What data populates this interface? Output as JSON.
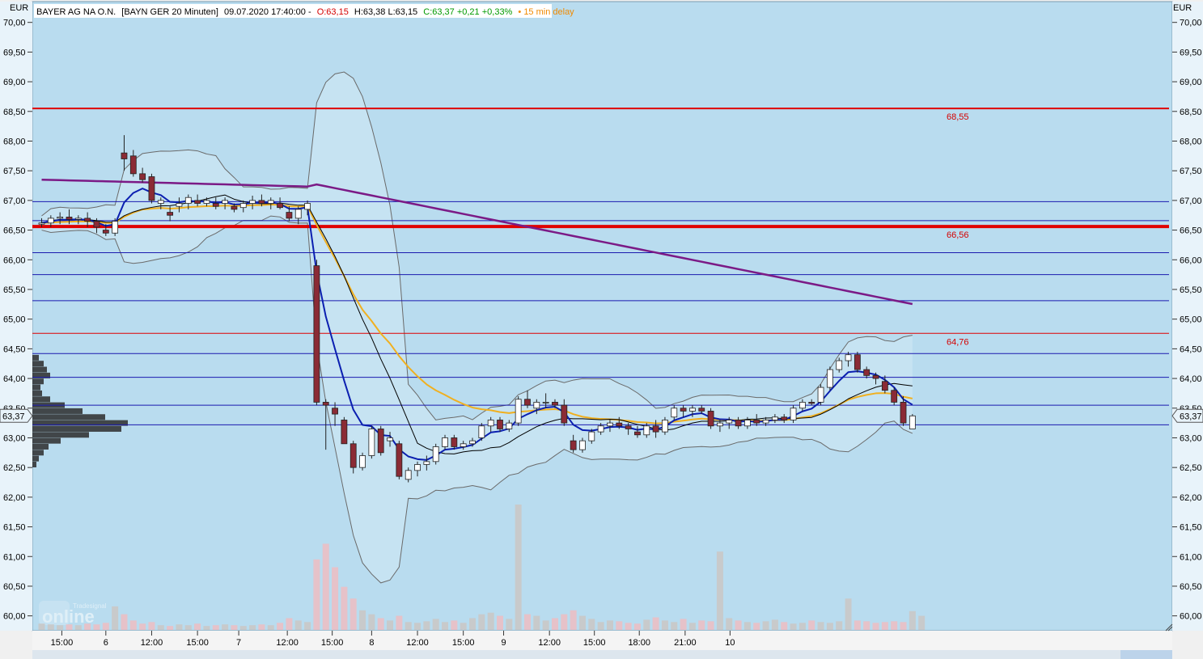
{
  "header": {
    "name": "BAYER AG NA O.N.",
    "symbol": "[BAYN GER 20 Minuten]",
    "datetime": "09.07.2020 17:40:00 -",
    "open": "O:63,15",
    "high_low": "H:63,38 L:63,15",
    "close_change": "C:63,37 +0,21 +0,33%",
    "delay": "• 15 min delay"
  },
  "currency_left": "EUR",
  "currency_right": "EUR",
  "last_price_label": "63,37",
  "watermark": {
    "brand": "Tradesignal",
    "text": "online"
  },
  "colors": {
    "plot_bg": "#b9dcef",
    "candle_up": "#ffffff",
    "candle_down": "#8b2b35",
    "resistance": "#e00000",
    "support_lines": "#1a1aaf",
    "sma_long": "#7b1a86",
    "sma_mid": "#f0b020",
    "ema_fast": "#0b1fb0",
    "ema_slow": "#000000",
    "bollinger": "#6a6a6a",
    "volume": "#c8c8c8"
  },
  "chart_data": {
    "type": "candlestick",
    "interval": "20 Minuten",
    "y_ticks": [
      "60,00",
      "60,50",
      "61,00",
      "61,50",
      "62,00",
      "62,50",
      "63,00",
      "63,50",
      "64,00",
      "64,50",
      "65,00",
      "65,50",
      "66,00",
      "66,50",
      "67,00",
      "67,50",
      "68,00",
      "68,50",
      "69,00",
      "69,50",
      "70,00"
    ],
    "ylim": [
      59.75,
      70.35
    ],
    "x_ticks": [
      {
        "bar": 2.2,
        "label": "15:00"
      },
      {
        "bar": 7,
        "label": "6"
      },
      {
        "bar": 12,
        "label": "12:00"
      },
      {
        "bar": 17,
        "label": "15:00"
      },
      {
        "bar": 21.5,
        "label": "7"
      },
      {
        "bar": 26.8,
        "label": "12:00"
      },
      {
        "bar": 31.7,
        "label": "15:00"
      },
      {
        "bar": 36,
        "label": "8"
      },
      {
        "bar": 41,
        "label": "12:00"
      },
      {
        "bar": 46,
        "label": "15:00"
      },
      {
        "bar": 50.4,
        "label": "9"
      },
      {
        "bar": 55.4,
        "label": "12:00"
      },
      {
        "bar": 60.3,
        "label": "15:00"
      },
      {
        "bar": 65.2,
        "label": "18:00"
      },
      {
        "bar": 70.2,
        "label": "21:00"
      },
      {
        "bar": 75.1,
        "label": "10"
      }
    ],
    "horizontal_levels": [
      {
        "price": 68.55,
        "label": "68,55",
        "role": "resistance",
        "width": 2
      },
      {
        "price": 66.56,
        "label": "66,56",
        "role": "resistance",
        "width": 4
      },
      {
        "price": 64.76,
        "label": "64,76",
        "role": "resistance",
        "width": 1
      },
      {
        "price": 66.98,
        "label": "",
        "role": "support",
        "width": 1
      },
      {
        "price": 66.66,
        "label": "",
        "role": "support",
        "width": 1
      },
      {
        "price": 66.12,
        "label": "",
        "role": "support",
        "width": 1
      },
      {
        "price": 65.75,
        "label": "",
        "role": "support",
        "width": 1
      },
      {
        "price": 65.31,
        "label": "",
        "role": "support",
        "width": 1
      },
      {
        "price": 64.42,
        "label": "",
        "role": "support",
        "width": 1
      },
      {
        "price": 64.02,
        "label": "",
        "role": "support",
        "width": 1
      },
      {
        "price": 63.55,
        "label": "",
        "role": "support",
        "width": 1
      },
      {
        "price": 63.22,
        "label": "",
        "role": "support",
        "width": 1
      }
    ],
    "candles": [
      [
        66.6,
        66.7,
        66.55,
        66.62
      ],
      [
        66.62,
        66.75,
        66.55,
        66.7
      ],
      [
        66.7,
        66.8,
        66.6,
        66.72
      ],
      [
        66.72,
        66.85,
        66.6,
        66.68
      ],
      [
        66.68,
        66.75,
        66.6,
        66.7
      ],
      [
        66.7,
        66.8,
        66.55,
        66.65
      ],
      [
        66.65,
        66.7,
        66.45,
        66.55
      ],
      [
        66.5,
        66.6,
        66.4,
        66.45
      ],
      [
        66.45,
        66.7,
        66.4,
        66.65
      ],
      [
        67.8,
        68.1,
        67.5,
        67.7
      ],
      [
        67.75,
        67.85,
        67.4,
        67.45
      ],
      [
        67.45,
        67.55,
        67.3,
        67.35
      ],
      [
        67.4,
        67.45,
        66.95,
        67.0
      ],
      [
        66.95,
        67.05,
        66.85,
        67.0
      ],
      [
        66.8,
        66.9,
        66.65,
        66.75
      ],
      [
        66.9,
        67.05,
        66.8,
        66.95
      ],
      [
        66.95,
        67.1,
        66.85,
        67.05
      ],
      [
        67.0,
        67.1,
        66.9,
        66.95
      ],
      [
        66.95,
        67.05,
        66.9,
        67.0
      ],
      [
        66.95,
        67.05,
        66.85,
        66.9
      ],
      [
        66.95,
        67.05,
        66.85,
        67.0
      ],
      [
        66.9,
        66.95,
        66.8,
        66.85
      ],
      [
        66.88,
        67.0,
        66.8,
        66.95
      ],
      [
        66.95,
        67.08,
        66.85,
        67.0
      ],
      [
        67.0,
        67.1,
        66.9,
        66.95
      ],
      [
        66.95,
        67.05,
        66.85,
        67.0
      ],
      [
        66.95,
        67.05,
        66.85,
        66.88
      ],
      [
        66.8,
        66.9,
        66.65,
        66.7
      ],
      [
        66.7,
        66.9,
        66.6,
        66.85
      ],
      [
        66.85,
        67.0,
        66.75,
        66.95
      ],
      [
        65.9,
        66.0,
        63.55,
        63.6
      ],
      [
        63.6,
        63.65,
        62.8,
        63.55
      ],
      [
        63.5,
        63.6,
        63.2,
        63.4
      ],
      [
        63.3,
        63.35,
        62.9,
        62.9
      ],
      [
        62.9,
        62.95,
        62.4,
        62.5
      ],
      [
        62.5,
        62.75,
        62.45,
        62.7
      ],
      [
        62.7,
        63.2,
        62.65,
        63.15
      ],
      [
        63.15,
        63.2,
        62.7,
        62.75
      ],
      [
        62.95,
        63.1,
        62.85,
        63.0
      ],
      [
        62.9,
        62.95,
        62.3,
        62.35
      ],
      [
        62.3,
        62.5,
        62.25,
        62.45
      ],
      [
        62.45,
        62.6,
        62.35,
        62.55
      ],
      [
        62.55,
        62.7,
        62.45,
        62.6
      ],
      [
        62.6,
        62.9,
        62.55,
        62.85
      ],
      [
        62.85,
        63.05,
        62.8,
        63.0
      ],
      [
        63.0,
        63.05,
        62.8,
        62.85
      ],
      [
        62.85,
        62.95,
        62.8,
        62.9
      ],
      [
        62.9,
        63.0,
        62.85,
        62.95
      ],
      [
        63.0,
        63.25,
        62.95,
        63.2
      ],
      [
        63.2,
        63.35,
        63.1,
        63.3
      ],
      [
        63.3,
        63.35,
        63.1,
        63.15
      ],
      [
        63.15,
        63.3,
        63.1,
        63.25
      ],
      [
        63.25,
        63.7,
        63.2,
        63.65
      ],
      [
        63.65,
        63.8,
        63.5,
        63.55
      ],
      [
        63.5,
        63.65,
        63.4,
        63.6
      ],
      [
        63.6,
        63.75,
        63.5,
        63.6
      ],
      [
        63.6,
        63.65,
        63.5,
        63.55
      ],
      [
        63.55,
        63.65,
        63.2,
        63.25
      ],
      [
        62.95,
        63.05,
        62.75,
        62.8
      ],
      [
        62.8,
        63.0,
        62.75,
        62.95
      ],
      [
        62.95,
        63.15,
        62.9,
        63.1
      ],
      [
        63.1,
        63.25,
        63.05,
        63.2
      ],
      [
        63.2,
        63.3,
        63.1,
        63.25
      ],
      [
        63.25,
        63.35,
        63.15,
        63.2
      ],
      [
        63.2,
        63.25,
        63.05,
        63.15
      ],
      [
        63.1,
        63.2,
        63.0,
        63.05
      ],
      [
        63.05,
        63.25,
        63.0,
        63.2
      ],
      [
        63.2,
        63.3,
        63.0,
        63.1
      ],
      [
        63.1,
        63.35,
        63.05,
        63.3
      ],
      [
        63.35,
        63.55,
        63.3,
        63.5
      ],
      [
        63.5,
        63.55,
        63.35,
        63.45
      ],
      [
        63.45,
        63.55,
        63.35,
        63.5
      ],
      [
        63.5,
        63.55,
        63.4,
        63.45
      ],
      [
        63.45,
        63.5,
        63.15,
        63.2
      ],
      [
        63.2,
        63.3,
        63.1,
        63.25
      ],
      [
        63.25,
        63.35,
        63.15,
        63.3
      ],
      [
        63.3,
        63.35,
        63.15,
        63.2
      ],
      [
        63.2,
        63.35,
        63.15,
        63.3
      ],
      [
        63.3,
        63.4,
        63.2,
        63.25
      ],
      [
        63.25,
        63.35,
        63.2,
        63.3
      ],
      [
        63.3,
        63.4,
        63.25,
        63.35
      ],
      [
        63.35,
        63.4,
        63.25,
        63.3
      ],
      [
        63.3,
        63.55,
        63.25,
        63.5
      ],
      [
        63.5,
        63.65,
        63.45,
        63.6
      ],
      [
        63.6,
        63.65,
        63.55,
        63.58
      ],
      [
        63.6,
        63.9,
        63.55,
        63.85
      ],
      [
        63.85,
        64.2,
        63.8,
        64.15
      ],
      [
        64.15,
        64.35,
        64.1,
        64.3
      ],
      [
        64.3,
        64.45,
        64.2,
        64.4
      ],
      [
        64.4,
        64.45,
        64.1,
        64.15
      ],
      [
        64.15,
        64.2,
        64.0,
        64.05
      ],
      [
        64.05,
        64.1,
        63.9,
        64.0
      ],
      [
        63.95,
        64.05,
        63.75,
        63.8
      ],
      [
        63.8,
        63.85,
        63.55,
        63.6
      ],
      [
        63.6,
        63.7,
        63.2,
        63.25
      ],
      [
        63.15,
        63.4,
        63.15,
        63.37
      ]
    ],
    "volume": [
      8,
      7,
      6,
      7,
      6,
      8,
      7,
      9,
      30,
      20,
      12,
      8,
      10,
      6,
      5,
      7,
      6,
      8,
      5,
      6,
      7,
      6,
      5,
      6,
      7,
      6,
      9,
      15,
      12,
      10,
      90,
      110,
      80,
      55,
      40,
      25,
      20,
      15,
      12,
      18,
      10,
      9,
      11,
      14,
      10,
      12,
      9,
      15,
      20,
      22,
      18,
      14,
      160,
      20,
      18,
      12,
      15,
      20,
      25,
      18,
      14,
      10,
      12,
      11,
      9,
      8,
      13,
      16,
      12,
      10,
      14,
      9,
      12,
      11,
      100,
      15,
      12,
      10,
      9,
      11,
      13,
      10,
      8,
      9,
      12,
      10,
      9,
      11,
      40,
      12,
      11,
      9,
      10,
      11,
      10,
      24,
      18
    ],
    "last": 63.37
  }
}
